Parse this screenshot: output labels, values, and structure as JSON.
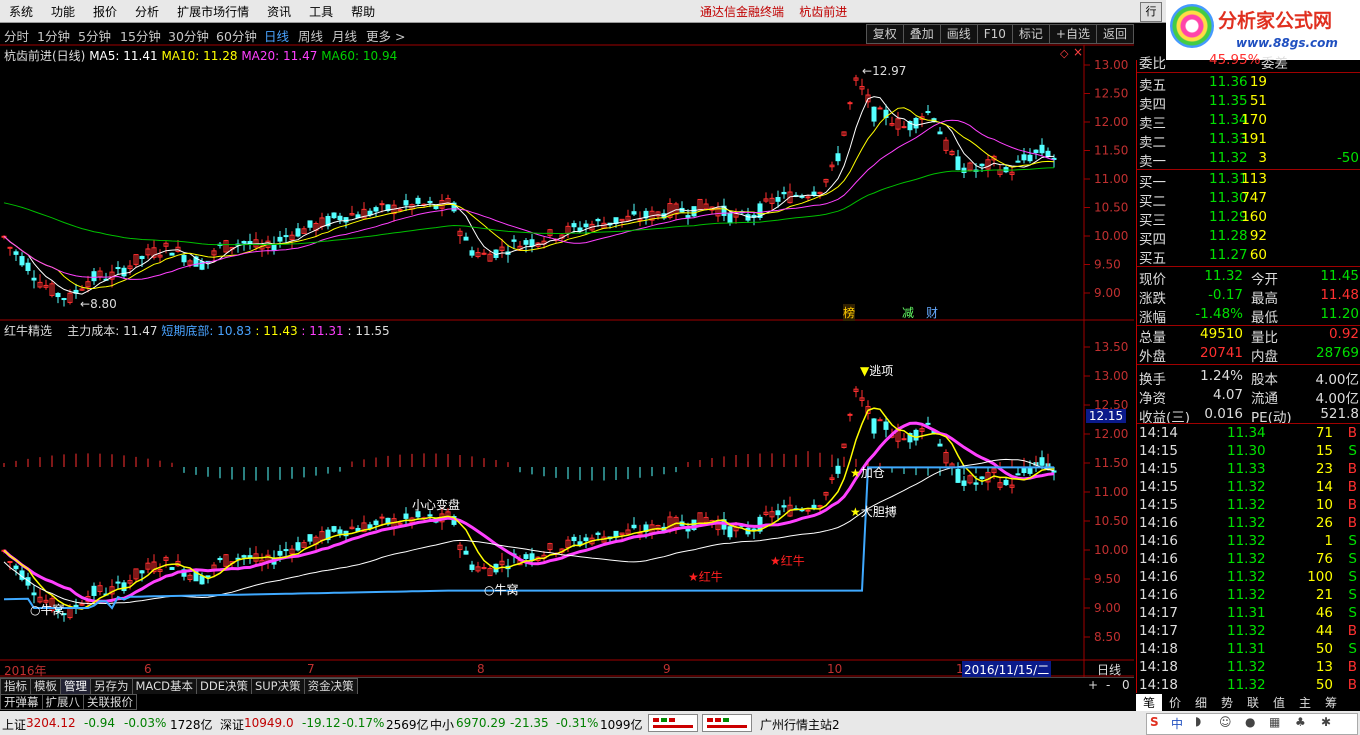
{
  "menu": {
    "items": [
      "系统",
      "功能",
      "报价",
      "分析",
      "扩展市场行情",
      "资讯",
      "工具",
      "帮助"
    ],
    "app_title": "通达信金融终端",
    "stock_name": "杭齿前进",
    "right_label": "行"
  },
  "logo": {
    "title": "分析家公式网",
    "url": "www.88gs.com"
  },
  "periods": {
    "items": [
      "分时",
      "1分钟",
      "5分钟",
      "15分钟",
      "30分钟",
      "60分钟",
      "日线",
      "周线",
      "月线",
      "更多 >"
    ],
    "active": "日线",
    "buttons": [
      "复权",
      "叠加",
      "画线",
      "F10",
      "标记",
      "+自选",
      "返回"
    ]
  },
  "main_chart": {
    "title": "杭齿前进(日线)",
    "ma5": "MA5: 11.41",
    "ma10": "MA10: 11.28",
    "ma20": "MA20: 11.47",
    "ma60": "MA60: 10.94",
    "y_ticks": [
      "13.00",
      "12.50",
      "12.00",
      "11.50",
      "11.00",
      "10.50",
      "10.00",
      "9.50",
      "9.00"
    ],
    "high_label": "12.97",
    "low_label": "8.80",
    "markers": [
      "榜",
      "减",
      "财"
    ]
  },
  "sub_chart": {
    "title": "红牛精选",
    "cost_label": "主力成本: 11.47",
    "bottom_label": "短期底部: 10.83",
    "v3": ": 11.43",
    "v4": ": 11.31",
    "v5": ": 11.55",
    "y_ticks": [
      "13.50",
      "13.00",
      "12.50",
      "12.00",
      "11.50",
      "11.00",
      "10.50",
      "10.00",
      "9.50",
      "9.00",
      "8.50"
    ],
    "price_tag": "12.15",
    "annotations": {
      "top": "逃项",
      "add": "加仓",
      "bold": "大胆搏",
      "careful": "小心变盘",
      "nest1": "牛窝",
      "nest2": "牛窝",
      "redbull1": "红牛",
      "redbull2": "红牛"
    }
  },
  "x_axis": {
    "labels": [
      "2016年",
      "6",
      "7",
      "8",
      "9",
      "10",
      "1"
    ],
    "date_tag": "2016/11/15/二",
    "period": "日线"
  },
  "quote": {
    "wei_bi": {
      "label": "委比",
      "value": "45.95%",
      "diff_label": "委差"
    },
    "asks": [
      {
        "label": "卖五",
        "price": "11.36",
        "vol": "19",
        "chg": ""
      },
      {
        "label": "卖四",
        "price": "11.35",
        "vol": "51",
        "chg": ""
      },
      {
        "label": "卖三",
        "price": "11.34",
        "vol": "170",
        "chg": ""
      },
      {
        "label": "卖二",
        "price": "11.33",
        "vol": "191",
        "chg": ""
      },
      {
        "label": "卖一",
        "price": "11.32",
        "vol": "3",
        "chg": "-50"
      }
    ],
    "bids": [
      {
        "label": "买一",
        "price": "11.31",
        "vol": "113"
      },
      {
        "label": "买二",
        "price": "11.30",
        "vol": "747"
      },
      {
        "label": "买三",
        "price": "11.29",
        "vol": "160"
      },
      {
        "label": "买四",
        "price": "11.28",
        "vol": "92"
      },
      {
        "label": "买五",
        "price": "11.27",
        "vol": "60"
      }
    ],
    "stats": [
      {
        "l1": "现价",
        "v1": "11.32",
        "l2": "今开",
        "v2": "11.45"
      },
      {
        "l1": "涨跌",
        "v1": "-0.17",
        "l2": "最高",
        "v2": "11.48"
      },
      {
        "l1": "涨幅",
        "v1": "-1.48%",
        "l2": "最低",
        "v2": "11.20"
      },
      {
        "l1": "总量",
        "v1": "49510",
        "l2": "量比",
        "v2": "0.92"
      },
      {
        "l1": "外盘",
        "v1": "20741",
        "l2": "内盘",
        "v2": "28769"
      },
      {
        "l1": "换手",
        "v1": "1.24%",
        "l2": "股本",
        "v2": "4.00亿"
      },
      {
        "l1": "净资",
        "v1": "4.07",
        "l2": "流通",
        "v2": "4.00亿"
      },
      {
        "l1": "收益(三)",
        "v1": "0.016",
        "l2": "PE(动)",
        "v2": "521.8"
      }
    ],
    "ticks": [
      {
        "t": "14:14",
        "p": "11.34",
        "v": "71",
        "d": "B"
      },
      {
        "t": "14:15",
        "p": "11.30",
        "v": "15",
        "d": "S"
      },
      {
        "t": "14:15",
        "p": "11.33",
        "v": "23",
        "d": "B"
      },
      {
        "t": "14:15",
        "p": "11.32",
        "v": "14",
        "d": "B"
      },
      {
        "t": "14:15",
        "p": "11.32",
        "v": "10",
        "d": "B"
      },
      {
        "t": "14:16",
        "p": "11.32",
        "v": "26",
        "d": "B"
      },
      {
        "t": "14:16",
        "p": "11.32",
        "v": "1",
        "d": "S"
      },
      {
        "t": "14:16",
        "p": "11.32",
        "v": "76",
        "d": "S"
      },
      {
        "t": "14:16",
        "p": "11.32",
        "v": "100",
        "d": "S"
      },
      {
        "t": "14:16",
        "p": "11.32",
        "v": "21",
        "d": "S"
      },
      {
        "t": "14:17",
        "p": "11.31",
        "v": "46",
        "d": "S"
      },
      {
        "t": "14:17",
        "p": "11.32",
        "v": "44",
        "d": "B"
      },
      {
        "t": "14:18",
        "p": "11.31",
        "v": "50",
        "d": "S"
      },
      {
        "t": "14:18",
        "p": "11.32",
        "v": "13",
        "d": "B"
      },
      {
        "t": "14:18",
        "p": "11.32",
        "v": "50",
        "d": "B"
      }
    ],
    "bottom_tabs": [
      "笔",
      "价",
      "细",
      "势",
      "联",
      "值",
      "主",
      "筹"
    ]
  },
  "tabs": {
    "row1": [
      "指标",
      "模板",
      "管理",
      "另存为",
      "MACD基本",
      "DDE决策",
      "SUP决策",
      "资金决策"
    ],
    "row1_active": "管理",
    "row2": [
      "开弹幕",
      "扩展八",
      "关联报价"
    ],
    "zoom": [
      "+",
      "-",
      "0"
    ]
  },
  "status": {
    "sh_label": "上证",
    "sh_val": "3204.12",
    "sh_chg": "-0.94",
    "sh_pct": "-0.03%",
    "sh_amt": "1728亿",
    "sz_label": "深证",
    "sz_val": "10949.0",
    "sz_chg": "-19.12",
    "sz_pct": "-0.17%",
    "sz_amt": "2569亿",
    "zx_label": "中小",
    "zx_val": "6970.29",
    "zx_chg": "-21.35",
    "zx_pct": "-0.31%",
    "zx_amt": "1099亿",
    "server": "广州行情主站2"
  },
  "colors": {
    "up": "#ff3030",
    "down": "#54ffff",
    "ma5": "#ffffff",
    "ma10": "#ffff00",
    "ma20": "#ff40ff",
    "ma60": "#00c000",
    "grid": "#800000"
  }
}
